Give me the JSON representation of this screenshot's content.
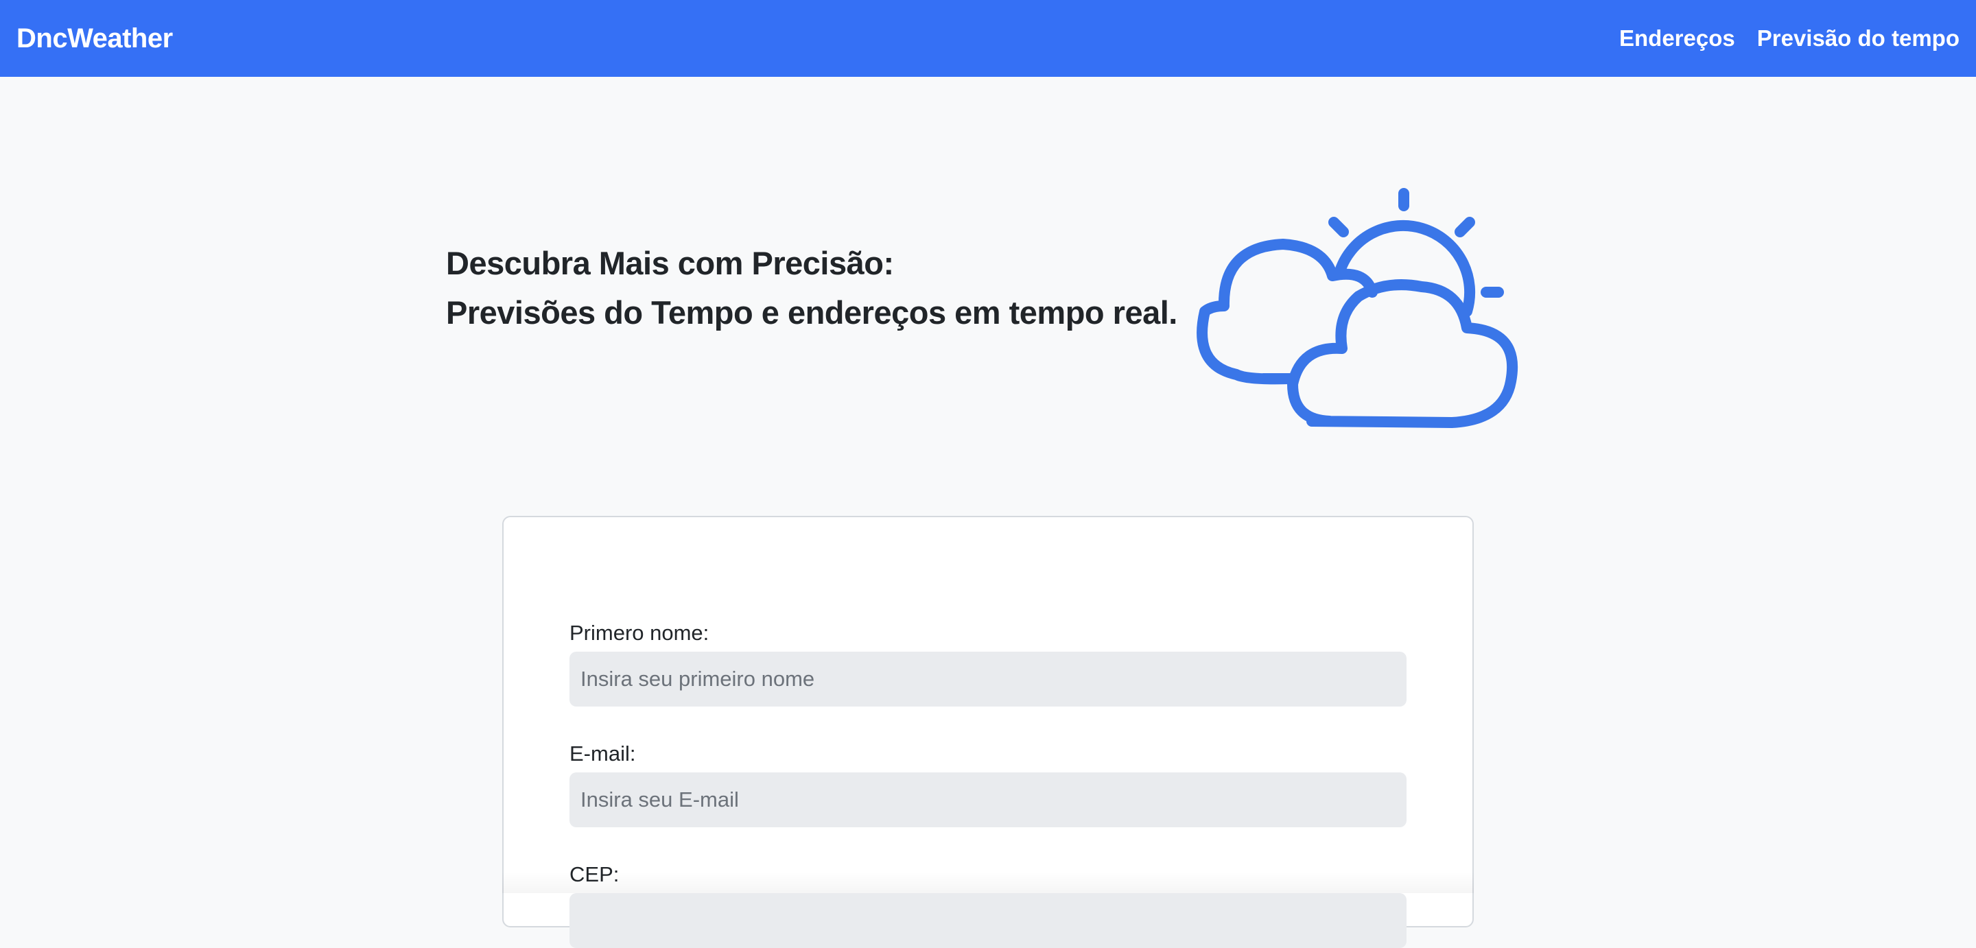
{
  "navbar": {
    "brand": "DncWeather",
    "links": [
      {
        "label": "Endereços"
      },
      {
        "label": "Previsão do tempo"
      }
    ],
    "background_color": "#3570f5"
  },
  "hero": {
    "line1": "Descubra Mais com Precisão:",
    "line2": "Previsões do Tempo e endereços em tempo real.",
    "illustration_icon": "partly-cloudy-icon",
    "accent_color": "#3a76e8"
  },
  "form": {
    "fields": [
      {
        "label": "Primero nome:",
        "placeholder": "Insira seu primeiro nome",
        "value": ""
      },
      {
        "label": "E-mail:",
        "placeholder": "Insira seu E-mail",
        "value": ""
      },
      {
        "label": "CEP:",
        "placeholder": "",
        "value": ""
      }
    ]
  }
}
